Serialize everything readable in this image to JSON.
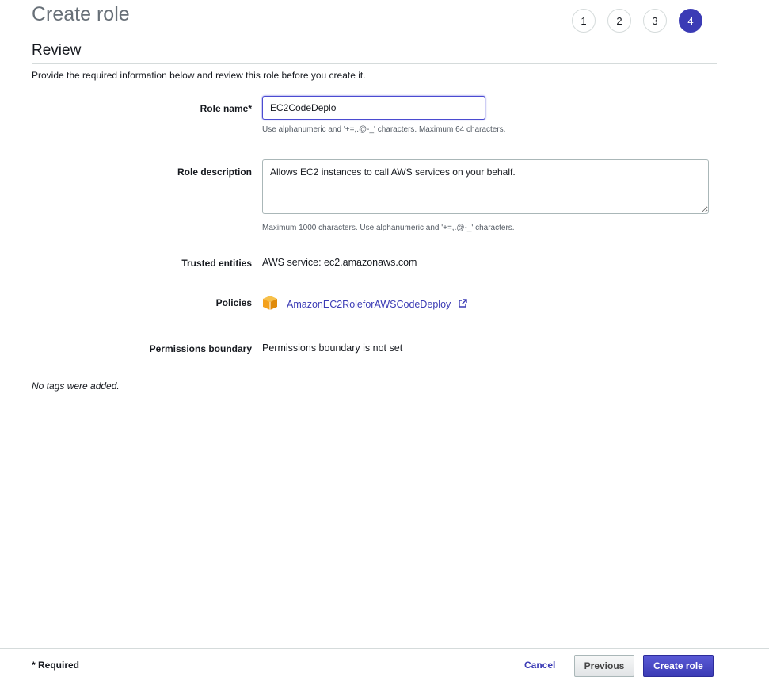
{
  "header": {
    "title": "Create role",
    "steps": [
      "1",
      "2",
      "3",
      "4"
    ],
    "active_step": "4"
  },
  "review": {
    "heading": "Review",
    "intro": "Provide the required information below and review this role before you create it."
  },
  "form": {
    "role_name": {
      "label": "Role name*",
      "value": "EC2CodeDeplo",
      "hint": "Use alphanumeric and '+=,.@-_' characters. Maximum 64 characters."
    },
    "role_description": {
      "label": "Role description",
      "value": "Allows EC2 instances to call AWS services on your behalf.",
      "hint": "Maximum 1000 characters. Use alphanumeric and '+=,.@-_' characters."
    },
    "trusted_entities": {
      "label": "Trusted entities",
      "value": "AWS service: ec2.amazonaws.com"
    },
    "policies": {
      "label": "Policies",
      "items": [
        {
          "name": "AmazonEC2RoleforAWSCodeDeploy",
          "icon": "policy-cube-icon"
        }
      ]
    },
    "permissions_boundary": {
      "label": "Permissions boundary",
      "value": "Permissions boundary is not set"
    }
  },
  "tags": {
    "empty_message": "No tags were added."
  },
  "footer": {
    "required_note": "* Required",
    "cancel_label": "Cancel",
    "previous_label": "Previous",
    "create_label": "Create role"
  },
  "colors": {
    "accent": "#3b3bb5",
    "policy_icon": "#f4a11d"
  }
}
